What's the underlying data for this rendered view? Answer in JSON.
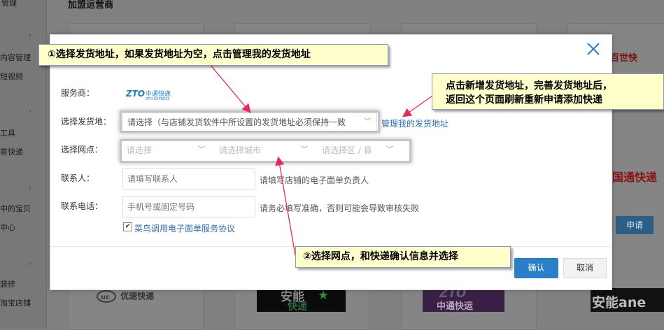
{
  "background": {
    "page_title": "加盟运营商",
    "sidebar_items": [
      "管理",
      "内容管理",
      "短视频",
      "工具",
      "寄快递",
      "中的宝贝",
      "中心",
      "装修",
      "淘宝店铺"
    ],
    "right_logo_text": "百世快",
    "right_label": "国通快递",
    "right_button": "申请",
    "bottom_logos": {
      "uc": "优速快递",
      "anneng_top": "安能",
      "anneng_bottom": "快递",
      "zto": "中通快运",
      "ane": "安能ane"
    }
  },
  "modal": {
    "close_icon": "close-icon",
    "provider": {
      "label": "服务商：",
      "logo_text": "ZTO中通快递",
      "logo_sub": "ZTO EXPRESS"
    },
    "address": {
      "label": "选择发货地：",
      "value": "请选择（与店铺发货软件中所设置的发货地址必须保持一致",
      "manage_link": "管理我的发货地址"
    },
    "branch": {
      "label": "选择网点：",
      "province_placeholder": "请选择",
      "city_placeholder": "请选择城市",
      "district_placeholder": "请选择区 / 县"
    },
    "contact": {
      "label": "联系人：",
      "placeholder": "请填写联系人",
      "hint": "请填写店铺的电子面单负责人"
    },
    "phone": {
      "label": "联系电话：",
      "placeholder": "手机号或固定号码",
      "hint": "请务必填写准确，否则可能会导致审核失败"
    },
    "agreement": {
      "checked": true,
      "text": "菜鸟调用电子面单服务协议"
    },
    "buttons": {
      "confirm": "确认",
      "cancel": "取消"
    }
  },
  "annotations": {
    "callout1": "①选择发货地址，如果发货地址为空，点击管理我的发货地址",
    "callout2_line1": "点击新增发货地址，完善发货地址后，",
    "callout2_line2": "返回这个页面刷新重新申请添加快递",
    "callout3": "②选择网点，和快递确认信息并选择",
    "arrow_color": "#e8295b"
  }
}
